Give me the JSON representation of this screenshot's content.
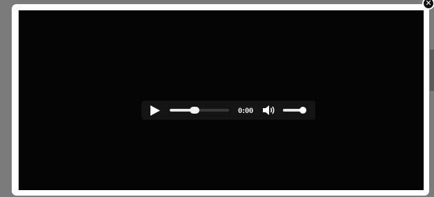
{
  "modal": {
    "close_glyph": "✕"
  },
  "player": {
    "play_icon": "play-icon",
    "progress_fraction": 0.42,
    "current_time": "0:00",
    "volume_icon": "volume-icon",
    "volume_fraction": 0.92
  },
  "colors": {
    "backdrop": "#7b7b7b",
    "modal_background": "#ffffff",
    "video_background": "#050505",
    "controls_background": "#141414",
    "control_foreground": "#ffffff"
  }
}
